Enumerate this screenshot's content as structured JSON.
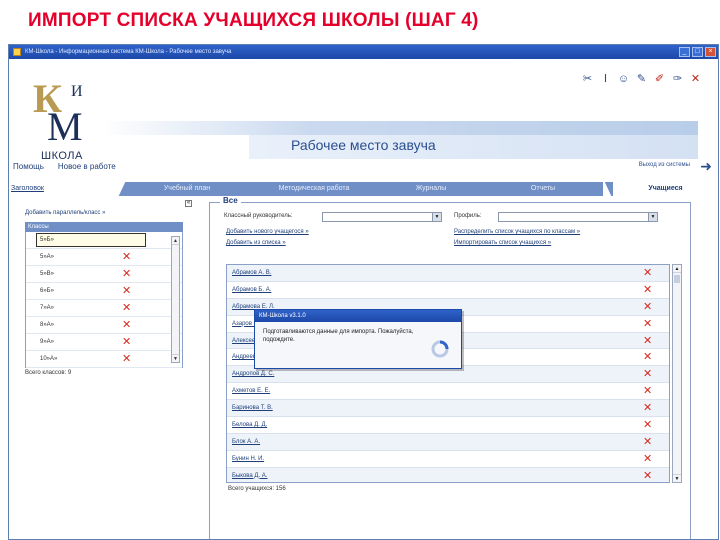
{
  "slide_title": "ИМПОРТ СПИСКА УЧАЩИХСЯ ШКОЛЫ (ШАГ 4)",
  "window": {
    "title": "КМ-Школа - Информационная система КМ-Школа - Рабочее место завуча"
  },
  "logo": {
    "letter_k": "К",
    "letter_i": "И",
    "letter_m": "М",
    "school": "ШКОЛА"
  },
  "header": {
    "workplace_title": "Рабочее место завуча"
  },
  "topnav": {
    "help": "Помощь",
    "news": "Новое в работе",
    "exit": "Выход из системы"
  },
  "tabs": [
    {
      "label": "Заголовок"
    },
    {
      "label": "Учебный план"
    },
    {
      "label": "Методическая работа"
    },
    {
      "label": "Журналы"
    },
    {
      "label": "Отчеты"
    },
    {
      "label": "Учащиеся"
    }
  ],
  "left_panel": {
    "add_class": "Добавить параллель/класс »",
    "classes_header": "Классы",
    "classes": [
      "5»Б»",
      "5»А»",
      "5»В»",
      "6»Б»",
      "7»А»",
      "8»А»",
      "9»А»",
      "10»А»",
      "11»А»"
    ],
    "classes_count": "Всего классов: 9"
  },
  "right_panel": {
    "legend": "Все",
    "class_teacher_label": "Классный руководитель:",
    "profile_label": "Профиль:",
    "add_student": "Добавить нового учащегося »",
    "add_from_list": "Добавить из списка »",
    "distribute": "Распределить список учащихся по классам »",
    "import_list": "Импортировать список учащихся »",
    "students": [
      "Абрамов А. В.",
      "Абрамов Б. А.",
      "Абрамова Е. Л.",
      "Азаров Г. Е.",
      "Алексеев Р. Р.",
      "Андреев П. М.",
      "Андропов Д. С.",
      "Ахметов Е. Е.",
      "Баринова Т. В.",
      "Белова Д. Д.",
      "Блок А. А.",
      "Бунин Н. И.",
      "Быкова Д. А."
    ],
    "students_count": "Всего учащихся: 156"
  },
  "dialog": {
    "title": "КМ-Школа v3.1.0",
    "message": "Подготавливаются данные для импорта. Пожалуйста, подождите."
  },
  "colors": {
    "title_red": "#e4002b",
    "tab_blue": "#6f8fc6",
    "delete_red": "#d82a1e",
    "link_blue": "#1f3f7a"
  }
}
